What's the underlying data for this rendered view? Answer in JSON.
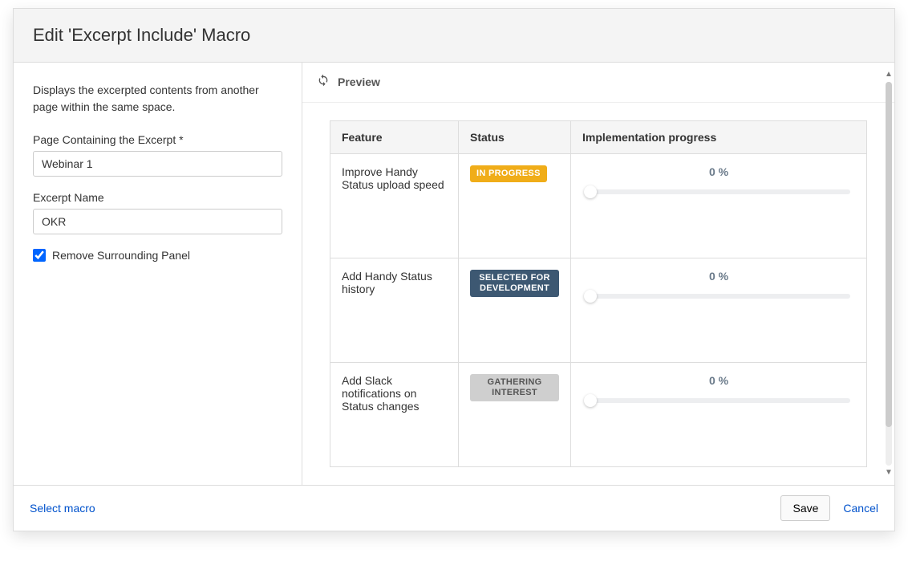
{
  "header": {
    "title": "Edit 'Excerpt Include' Macro"
  },
  "sidebar": {
    "description": "Displays the excerpted contents from another page within the same space.",
    "page_label": "Page Containing the Excerpt *",
    "page_value": "Webinar 1",
    "name_label": "Excerpt Name",
    "name_value": "OKR",
    "remove_panel_label": "Remove Surrounding Panel",
    "remove_panel_checked": true
  },
  "preview": {
    "label": "Preview",
    "columns": [
      "Feature",
      "Status",
      "Implementation progress"
    ],
    "rows": [
      {
        "feature": "Improve Handy Status upload speed",
        "status": "IN PROGRESS",
        "status_style": "yellow",
        "progress_label": "0 %",
        "progress_value": 0
      },
      {
        "feature": "Add Handy Status history",
        "status": "SELECTED FOR DEVELOPMENT",
        "status_style": "blue",
        "progress_label": "0 %",
        "progress_value": 0
      },
      {
        "feature": "Add Slack notifications on Status changes",
        "status": "GATHERING INTEREST",
        "status_style": "grey",
        "progress_label": "0 %",
        "progress_value": 0
      }
    ]
  },
  "footer": {
    "select_macro": "Select macro",
    "save": "Save",
    "cancel": "Cancel"
  }
}
